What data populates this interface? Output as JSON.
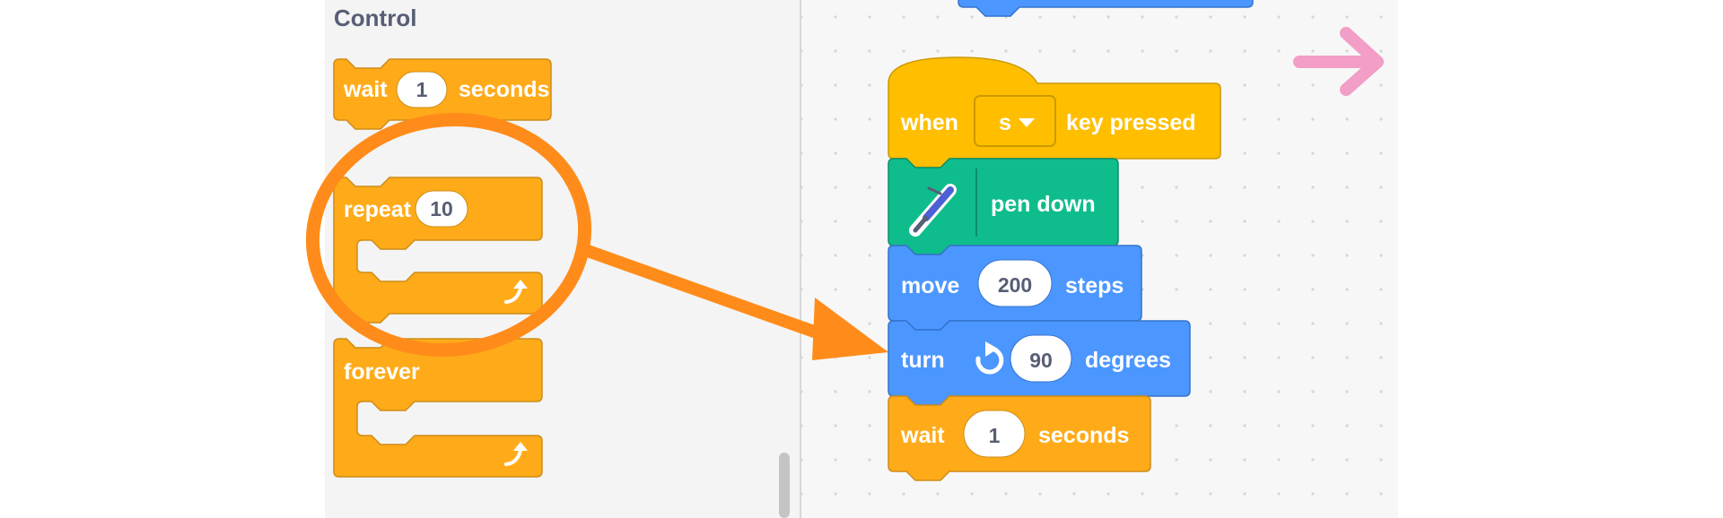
{
  "palette": {
    "category_title": "Control",
    "wait_block": {
      "label_1": "wait",
      "value": "1",
      "label_2": "seconds"
    },
    "repeat_block": {
      "label": "repeat",
      "value": "10"
    },
    "forever_block": {
      "label": "forever"
    }
  },
  "workspace": {
    "hat_block": {
      "label_1": "when",
      "key": "s",
      "label_2": "key pressed"
    },
    "pen_block": {
      "label": "pen down"
    },
    "move_block": {
      "label_1": "move",
      "value": "200",
      "label_2": "steps"
    },
    "turn_block": {
      "label_1": "turn",
      "value": "90",
      "label_2": "degrees"
    },
    "wait_block": {
      "label_1": "wait",
      "value": "1",
      "label_2": "seconds"
    }
  },
  "colors": {
    "control": "#FFAB19",
    "control_dark": "#F79D00",
    "events": "#FFBF00",
    "pen": "#0FBD8C",
    "motion": "#4C97FF",
    "annotation_arrow": "#FF8C1A",
    "pink_arrow": "#F29EC6"
  },
  "icons": [
    "loop-arrow-icon",
    "rotate-right-icon",
    "pen-icon",
    "dropdown-caret-icon"
  ]
}
